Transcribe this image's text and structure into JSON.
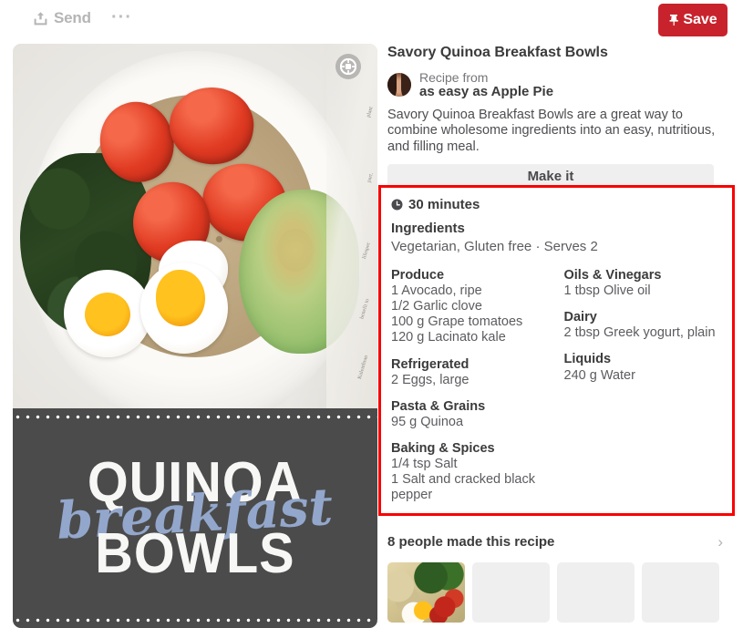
{
  "topbar": {
    "send_label": "Send",
    "send_icon": "share-upload-icon",
    "more_label": "···",
    "save_label": "Save",
    "save_icon": "pushpin-icon",
    "save_color": "#c8232c"
  },
  "media": {
    "visual_search_icon": "visual-search-icon",
    "caption": {
      "line1": "QUINOA",
      "line2": "breakfast",
      "line3": "BOWLS",
      "script_color": "#93a7cc",
      "panel_color": "#4b4b4b"
    },
    "newsprint": [
      "Kulenthran",
      "benefit to",
      "lifespec",
      "part.",
      "plant",
      "upon"
    ]
  },
  "pin": {
    "title": "Savory Quinoa Breakfast Bowls",
    "attribution_prefix": "Recipe from",
    "attribution_source": "as easy as Apple Pie",
    "description": "Savory Quinoa Breakfast Bowls are a great way to combine wholesome ingredients into an easy, nutritious, and filling meal.",
    "make_it_label": "Make it"
  },
  "recipe": {
    "highlight_color": "#f90000",
    "clock_icon": "clock-icon",
    "time": "30 minutes",
    "ingredients_heading": "Ingredients",
    "meta": "Vegetarian, Gluten free · Serves 2",
    "columns": [
      {
        "groups": [
          {
            "title": "Produce",
            "items": [
              "1 Avocado, ripe",
              "1/2 Garlic clove",
              "100 g Grape tomatoes",
              "120 g Lacinato kale"
            ]
          },
          {
            "title": "Refrigerated",
            "items": [
              "2 Eggs, large"
            ]
          },
          {
            "title": "Pasta & Grains",
            "items": [
              "95 g Quinoa"
            ]
          },
          {
            "title": "Baking & Spices",
            "items": [
              "1/4 tsp Salt",
              "1 Salt and cracked black pepper"
            ]
          }
        ]
      },
      {
        "groups": [
          {
            "title": "Oils & Vinegars",
            "items": [
              "1 tbsp Olive oil"
            ]
          },
          {
            "title": "Dairy",
            "items": [
              "2 tbsp Greek yogurt, plain"
            ]
          },
          {
            "title": "Liquids",
            "items": [
              "240 g Water"
            ]
          }
        ]
      }
    ]
  },
  "made": {
    "title": "8 people made this recipe",
    "chevron_icon": "chevron-right-icon",
    "thumbnails": [
      {
        "filled": true
      },
      {
        "filled": false
      },
      {
        "filled": false
      },
      {
        "filled": false
      }
    ]
  }
}
